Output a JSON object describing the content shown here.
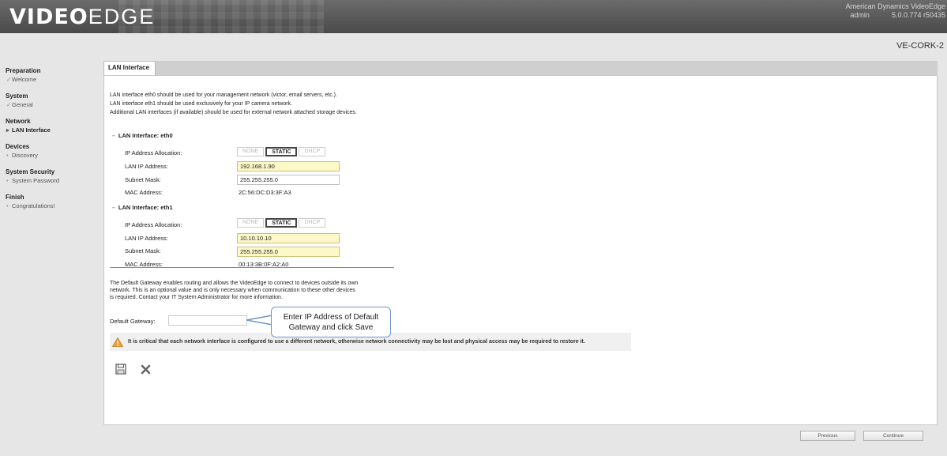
{
  "header": {
    "logo_bold": "VIDEO",
    "logo_light": "EDGE",
    "product_name": "American Dynamics VideoEdge",
    "user": "admin",
    "version": "5.0.0.774 r50435"
  },
  "hostname": "VE-CORK-2",
  "sidebar": {
    "sections": [
      {
        "title": "Preparation",
        "items": [
          {
            "label": "Welcome",
            "state": "done",
            "marker": "✓"
          }
        ]
      },
      {
        "title": "System",
        "items": [
          {
            "label": "General",
            "state": "done",
            "marker": "✓"
          }
        ]
      },
      {
        "title": "Network",
        "items": [
          {
            "label": "LAN Interface",
            "state": "active",
            "marker": "▸"
          }
        ]
      },
      {
        "title": "Devices",
        "items": [
          {
            "label": "Discovery",
            "state": "pending",
            "marker": "•"
          }
        ]
      },
      {
        "title": "System Security",
        "items": [
          {
            "label": "System Password",
            "state": "pending",
            "marker": "•"
          }
        ]
      },
      {
        "title": "Finish",
        "items": [
          {
            "label": "Congratulations!",
            "state": "pending",
            "marker": "•"
          }
        ]
      }
    ]
  },
  "tab": {
    "label": "LAN Interface"
  },
  "intro": {
    "line1": "LAN interface eth0 should be used for your management network (victor, email servers, etc.).",
    "line2": "LAN interface eth1 should be used exclusively for your IP camera network.",
    "line3": "Additional LAN interfaces (if available) should be used for external network attached storage devices."
  },
  "eth0": {
    "heading": "LAN Interface: eth0",
    "alloc_label": "IP Address Allocation:",
    "alloc_options": {
      "none": "NONE",
      "static": "STATIC",
      "dhcp": "DHCP"
    },
    "alloc_selected": "STATIC",
    "ip_label": "LAN IP Address:",
    "ip_value": "192.168.1.90",
    "mask_label": "Subnet Mask:",
    "mask_value": "255.255.255.0",
    "mac_label": "MAC Address:",
    "mac_value": "2C:56:DC:D3:3F:A3"
  },
  "eth1": {
    "heading": "LAN Interface: eth1",
    "alloc_label": "IP Address Allocation:",
    "alloc_options": {
      "none": "NONE",
      "static": "STATIC",
      "dhcp": "DHCP"
    },
    "alloc_selected": "STATIC",
    "ip_label": "LAN IP Address:",
    "ip_value": "10.10.10.10",
    "mask_label": "Subnet Mask:",
    "mask_value": "255.255.255.0",
    "mac_label": "MAC Address:",
    "mac_value": "00:13:3B:0F:A2:A0"
  },
  "gateway": {
    "description_l1": "The Default Gateway enables routing and allows the VideoEdge to connect to devices outside its own",
    "description_l2": "network. This is an optional value and is only necessary when communication to these other devices",
    "description_l3": "is required. Contact your IT System Administrator for more information.",
    "label": "Default Gateway:",
    "value": ""
  },
  "warning": {
    "text": "It is critical that each network interface is configured to use a different network, otherwise network connectivity may be lost and physical access may be required to restore it."
  },
  "callout": {
    "line1": "Enter IP Address of Default",
    "line2": "Gateway and click Save"
  },
  "icons": {
    "save": "save-icon",
    "cancel": "close-icon",
    "warning": "warning-icon"
  },
  "colors": {
    "highlight_field": "#fdf8c8",
    "callout_border": "#6f93c7",
    "check": "#7a9e3a",
    "warning": "#e8a13a"
  },
  "footer": {
    "previous": "Previous",
    "continue": "Continue"
  }
}
